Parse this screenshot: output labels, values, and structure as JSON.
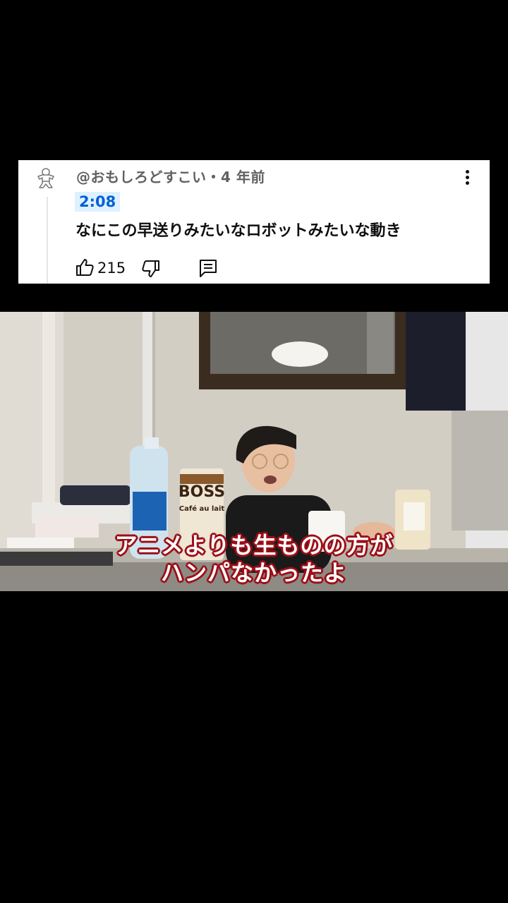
{
  "comment": {
    "author": "@おもしろどすこい",
    "separator": "・",
    "age": "4 年前",
    "timestamp": "2:08",
    "text": "なにこの早送りみたいなロボットみたいな動き",
    "like_count": "215"
  },
  "video": {
    "caption_line1": "アニメよりも生ものの方が",
    "caption_line2": "ハンパなかったよ",
    "can_label": "BOSS",
    "can_sub": "Café au lait"
  },
  "colors": {
    "timestamp_bg": "#def1ff",
    "timestamp_text": "#065fd4",
    "caption_outline": "#9b0f17"
  }
}
